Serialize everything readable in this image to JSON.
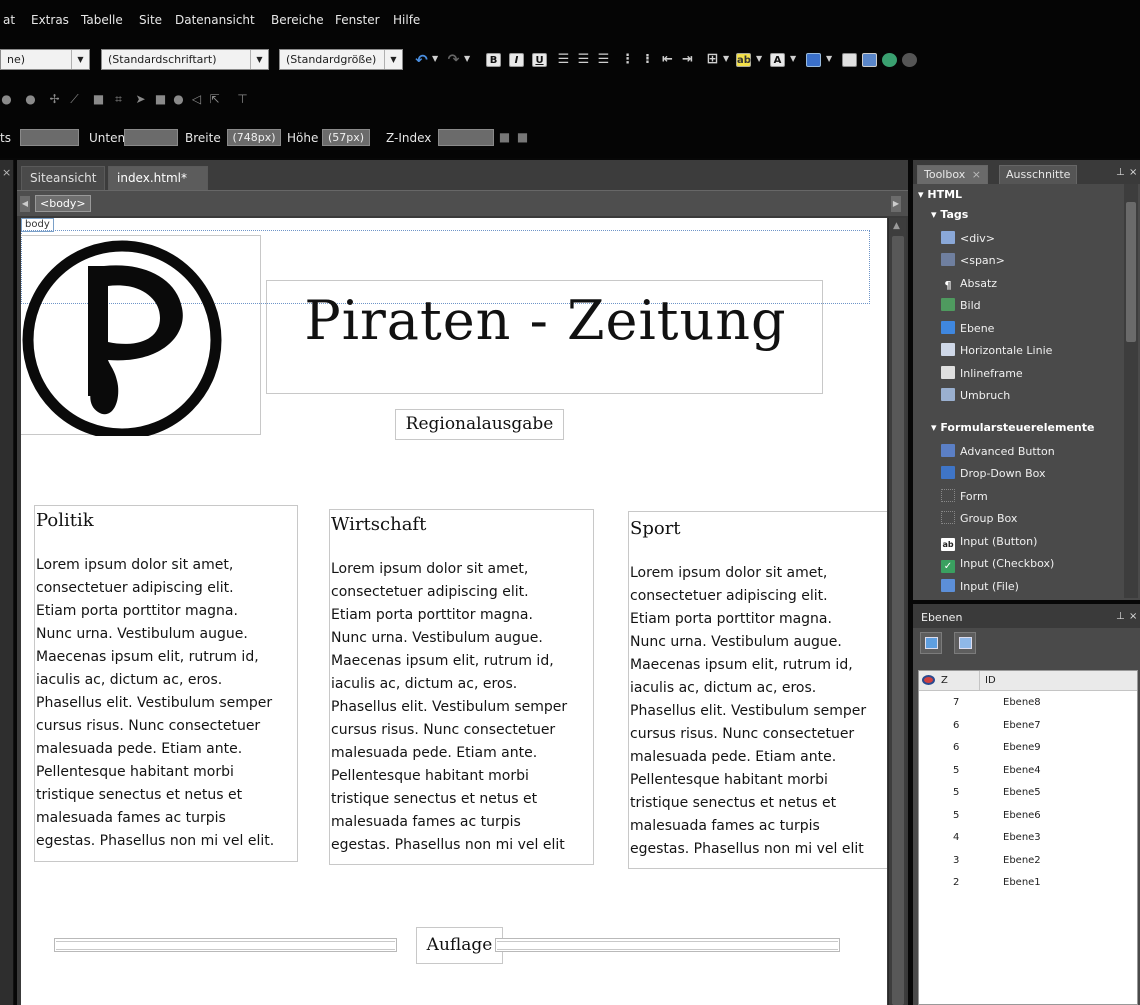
{
  "menu": {
    "items": [
      "at",
      "Extras",
      "Tabelle",
      "Site",
      "Datenansicht",
      "Bereiche",
      "Fenster",
      "Hilfe"
    ]
  },
  "toolbar": {
    "combo_element": "ne)",
    "combo_font": "(Standardschriftart)",
    "combo_size": "(Standardgröße)",
    "bold": "B",
    "italic": "I",
    "underline": "U"
  },
  "position_bar": {
    "cut_label": "ts",
    "unten_label": "Unten",
    "breite_label": "Breite",
    "breite_value": "(748px)",
    "hoehe_label": "Höhe",
    "hoehe_value": "(57px)",
    "zindex_label": "Z-Index"
  },
  "doc_tabs": {
    "site_view": "Siteansicht",
    "file_tab": "index.html*",
    "close_glyph": "×"
  },
  "breadcrumb": {
    "body_tag": "<body>",
    "body_label": "body"
  },
  "page": {
    "title": "Piraten - Zeitung",
    "subtitle": "Regionalausgabe",
    "footer_label": "Auflage",
    "columns": [
      {
        "heading": "Politik",
        "lines": [
          "Lorem ipsum dolor sit amet,",
          "consectetuer adipiscing elit.",
          "Etiam porta porttitor magna.",
          "Nunc urna. Vestibulum augue.",
          "Maecenas ipsum elit, rutrum id,",
          "iaculis ac, dictum ac, eros.",
          "Phasellus elit. Vestibulum semper",
          "cursus risus. Nunc consectetuer",
          "malesuada pede. Etiam ante.",
          "Pellentesque habitant morbi",
          "tristique senectus et netus et",
          "malesuada fames ac turpis",
          "egestas. Phasellus non mi vel elit."
        ]
      },
      {
        "heading": "Wirtschaft",
        "lines": [
          "Lorem ipsum dolor sit amet,",
          "consectetuer adipiscing elit.",
          "Etiam porta porttitor magna.",
          "Nunc urna. Vestibulum augue.",
          "Maecenas ipsum elit, rutrum id,",
          "iaculis ac, dictum ac, eros.",
          "Phasellus elit. Vestibulum semper",
          "cursus risus. Nunc consectetuer",
          "malesuada pede. Etiam ante.",
          "Pellentesque habitant morbi",
          "tristique senectus et netus et",
          "malesuada fames ac turpis",
          "egestas. Phasellus non mi vel elit"
        ]
      },
      {
        "heading": "Sport",
        "lines": [
          "Lorem ipsum dolor sit amet,",
          "consectetuer adipiscing elit.",
          "Etiam porta porttitor magna.",
          "Nunc urna. Vestibulum augue.",
          "Maecenas ipsum elit, rutrum id,",
          "iaculis ac, dictum ac, eros.",
          "Phasellus elit. Vestibulum semper",
          "cursus risus. Nunc consectetuer",
          "malesuada pede. Etiam ante.",
          "Pellentesque habitant morbi",
          "tristique senectus et netus et",
          "malesuada fames ac turpis",
          "egestas. Phasellus non mi vel elit"
        ]
      }
    ]
  },
  "toolbox": {
    "tab_toolbox": "Toolbox",
    "tab_close": "×",
    "tab_ausschnitte": "Ausschnitte",
    "group_html": "HTML",
    "group_tags": "Tags",
    "tags": [
      "<div>",
      "<span>",
      "Absatz",
      "Bild",
      "Ebene",
      "Horizontale Linie",
      "Inlineframe",
      "Umbruch"
    ],
    "group_forms": "Formularsteuerelemente",
    "forms": [
      "Advanced Button",
      "Drop-Down Box",
      "Form",
      "Group Box",
      "Input (Button)",
      "Input (Checkbox)",
      "Input (File)"
    ]
  },
  "layers": {
    "title": "Ebenen",
    "col_z": "Z",
    "col_id": "ID",
    "rows": [
      {
        "z": "7",
        "id": "Ebene8"
      },
      {
        "z": "6",
        "id": "Ebene7"
      },
      {
        "z": "6",
        "id": "Ebene9"
      },
      {
        "z": "5",
        "id": "Ebene4"
      },
      {
        "z": "5",
        "id": "Ebene5"
      },
      {
        "z": "5",
        "id": "Ebene6"
      },
      {
        "z": "4",
        "id": "Ebene3"
      },
      {
        "z": "3",
        "id": "Ebene2"
      },
      {
        "z": "2",
        "id": "Ebene1"
      }
    ]
  },
  "icons": {
    "pirate_logo": "pirate-party-logo-icon",
    "eye": "eye-icon"
  }
}
